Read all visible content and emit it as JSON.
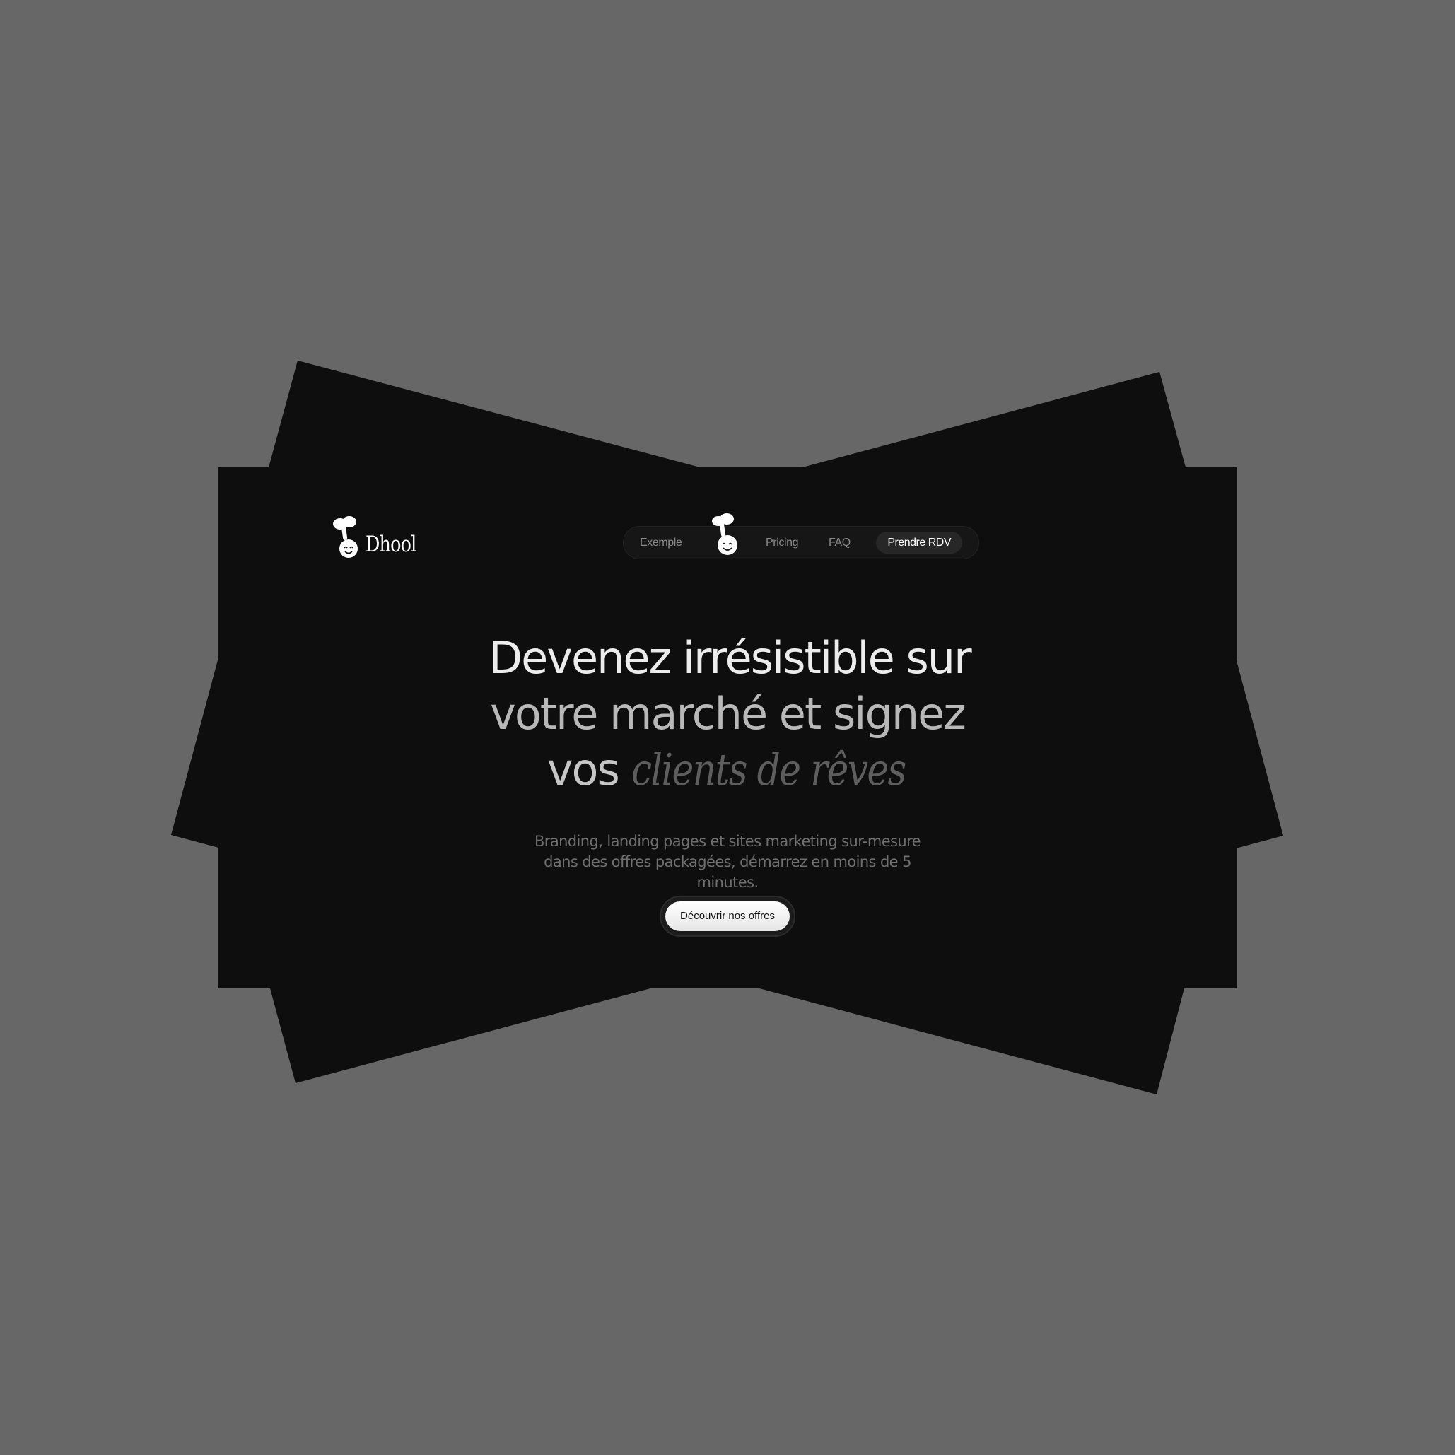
{
  "brand": {
    "name": "Dhool",
    "logo_icon": "mascot-icon"
  },
  "nav": {
    "links": [
      "Exemple",
      "Pricing",
      "FAQ"
    ],
    "cta": "Prendre RDV",
    "center_icon": "mascot-icon"
  },
  "hero": {
    "headline_line1": "Devenez irrésistible sur",
    "headline_line2": "votre marché et signez",
    "headline_line3_plain": "vos",
    "headline_line3_italic": "clients de rêves",
    "subtitle": "Branding, landing pages et sites marketing sur-mesure dans des offres packagées, démarrez en moins de 5 minutes.",
    "cta": "Découvrir nos offres"
  },
  "colors": {
    "page_background": "#676767",
    "hero_background": "#0e0e0e",
    "nav_background": "#161616",
    "cta_background": "#ffffff"
  }
}
